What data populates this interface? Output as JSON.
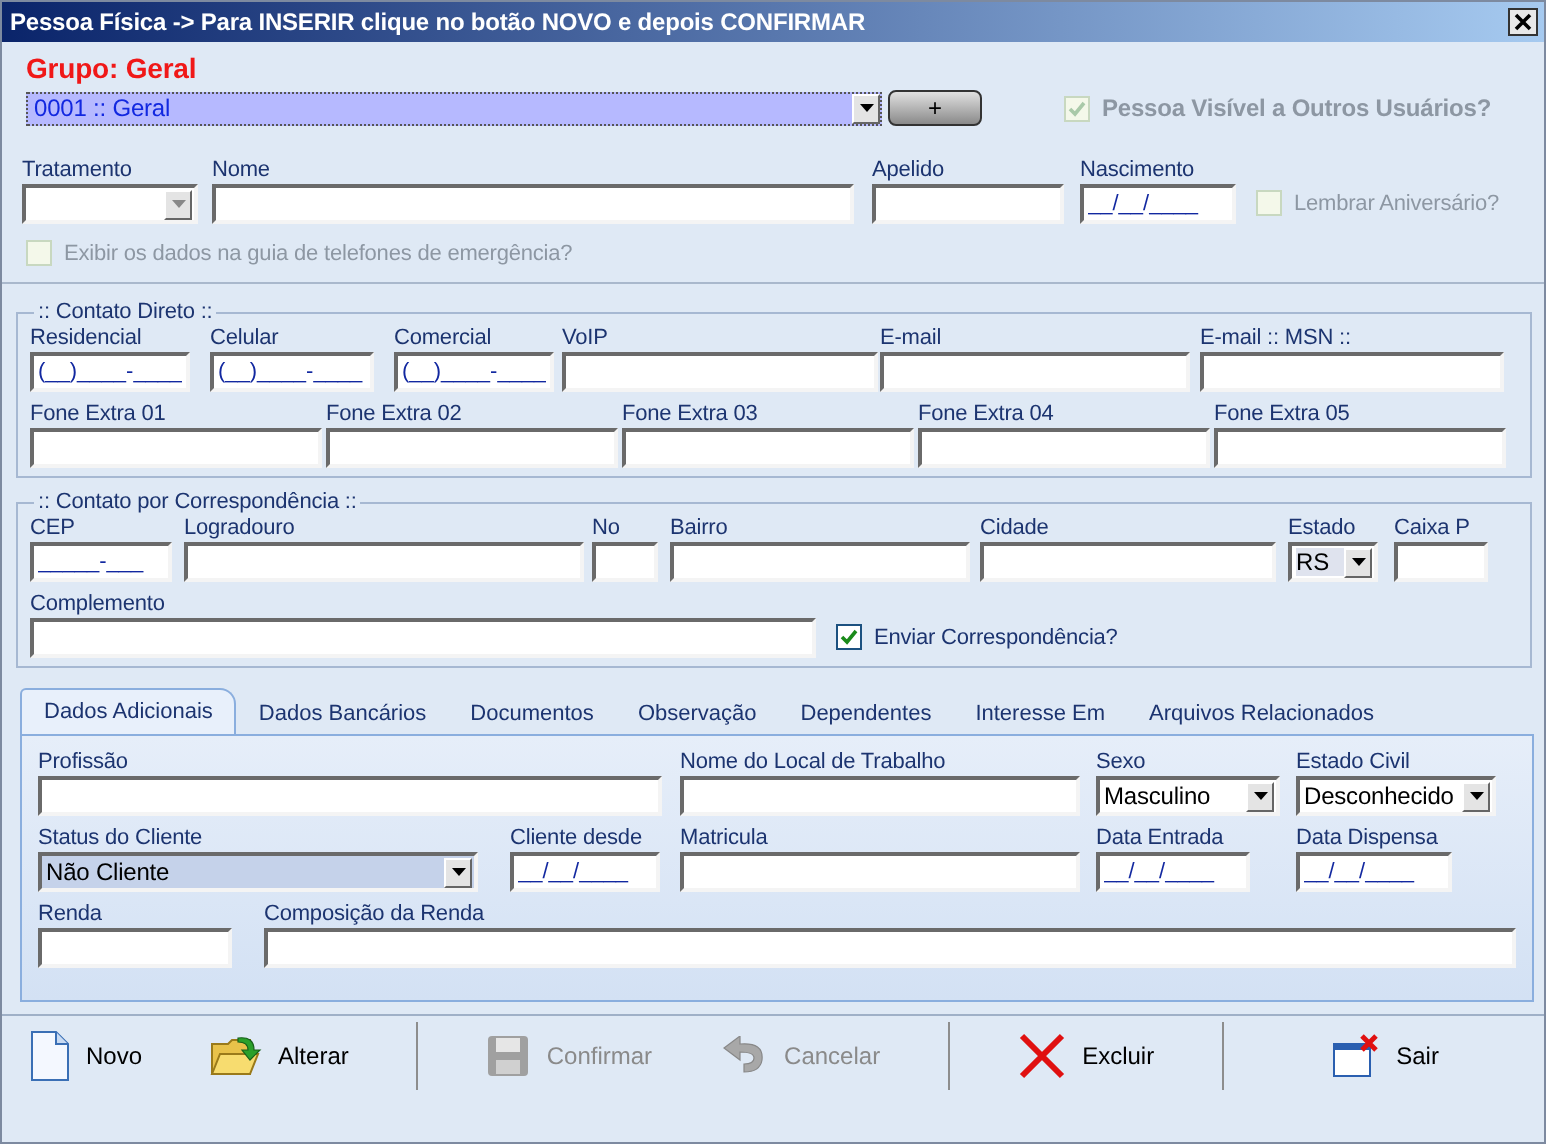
{
  "window": {
    "title": "Pessoa Física -> Para INSERIR clique no botão NOVO e depois CONFIRMAR"
  },
  "group": {
    "label": "Grupo: Geral",
    "value": "0001 :: Geral",
    "add_button": "+"
  },
  "visible_checkbox": {
    "label": "Pessoa Visível a Outros Usuários?",
    "checked": true,
    "disabled": true
  },
  "personal_fields": [
    {
      "kind": "select",
      "label": "Tratamento"
    },
    {
      "kind": "text",
      "label": "Nome"
    },
    {
      "kind": "text",
      "label": "Apelido"
    },
    {
      "kind": "text",
      "label": "Nascimento",
      "value": "__/__/____"
    }
  ],
  "birthday_checkbox": {
    "label": "Lembrar Aniversário?",
    "checked": false,
    "disabled": true
  },
  "emergency_checkbox": {
    "label": "Exibir os dados na guia de telefones de emergência?",
    "checked": false,
    "disabled": true
  },
  "direct_contact": {
    "legend": ":: Contato Direto ::",
    "phone_fields": [
      {
        "kind": "text",
        "label": "Residencial",
        "value": "(__)____-____"
      },
      {
        "kind": "text",
        "label": "Celular",
        "value": "(__)____-____"
      },
      {
        "kind": "text",
        "label": "Comercial",
        "value": "(__)____-____"
      },
      {
        "kind": "text",
        "label": "VoIP"
      },
      {
        "kind": "text",
        "label": "E-mail"
      },
      {
        "kind": "text",
        "label": "E-mail :: MSN ::"
      }
    ],
    "extra_fields": [
      {
        "kind": "text",
        "label": "Fone Extra 01"
      },
      {
        "kind": "text",
        "label": "Fone Extra 02"
      },
      {
        "kind": "text",
        "label": "Fone Extra 03"
      },
      {
        "kind": "text",
        "label": "Fone Extra 04"
      },
      {
        "kind": "text",
        "label": "Fone Extra 05"
      }
    ]
  },
  "mail_contact": {
    "legend": ":: Contato por Correspondência ::",
    "address_fields": [
      {
        "kind": "text",
        "label": "CEP",
        "value": "_____-___"
      },
      {
        "kind": "text",
        "label": "Logradouro"
      },
      {
        "kind": "text",
        "label": "No"
      },
      {
        "kind": "text",
        "label": "Bairro"
      },
      {
        "kind": "text",
        "label": "Cidade"
      },
      {
        "kind": "select",
        "label": "Estado",
        "value": "RS"
      },
      {
        "kind": "text",
        "label": "Caixa P"
      }
    ],
    "complement_field": {
      "kind": "text",
      "label": "Complemento"
    },
    "send_checkbox": {
      "label": "Enviar Correspondência?",
      "checked": true,
      "disabled": false
    }
  },
  "tabs": [
    {
      "label": "Dados Adicionais",
      "selected": true
    },
    {
      "label": "Dados Bancários",
      "selected": false
    },
    {
      "label": "Documentos",
      "selected": false
    },
    {
      "label": "Observação",
      "selected": false
    },
    {
      "label": "Dependentes",
      "selected": false
    },
    {
      "label": "Interesse Em",
      "selected": false
    },
    {
      "label": "Arquivos Relacionados",
      "selected": false
    }
  ],
  "tab_panel": {
    "work_fields": [
      {
        "kind": "text",
        "label": "Profissão"
      },
      {
        "kind": "text",
        "label": "Nome do Local de Trabalho"
      },
      {
        "kind": "select",
        "label": "Sexo",
        "value": "Masculino"
      },
      {
        "kind": "select",
        "label": "Estado Civil",
        "value": "Desconhecido"
      }
    ],
    "client_fields": [
      {
        "kind": "select",
        "label": "Status do Cliente",
        "value": "Não Cliente"
      },
      {
        "kind": "text",
        "label": "Cliente desde",
        "value": "__/__/____"
      },
      {
        "kind": "text",
        "label": "Matricula"
      },
      {
        "kind": "text",
        "label": "Data Entrada",
        "value": "__/__/____"
      },
      {
        "kind": "text",
        "label": "Data Dispensa",
        "value": "__/__/____"
      }
    ],
    "income_fields": [
      {
        "kind": "text",
        "label": "Renda"
      },
      {
        "kind": "text",
        "label": "Composição da Renda"
      }
    ]
  },
  "toolbar": [
    {
      "kind": "new",
      "label": "Novo",
      "disabled": false,
      "separator_before": false
    },
    {
      "kind": "edit",
      "label": "Alterar",
      "disabled": false,
      "separator_before": false
    },
    {
      "kind": "save",
      "label": "Confirmar",
      "disabled": true,
      "separator_before": true
    },
    {
      "kind": "cancel",
      "label": "Cancelar",
      "disabled": true,
      "separator_before": false
    },
    {
      "kind": "delete",
      "label": "Excluir",
      "disabled": false,
      "separator_before": true
    },
    {
      "kind": "exit",
      "label": "Sair",
      "disabled": false,
      "separator_before": true
    }
  ]
}
